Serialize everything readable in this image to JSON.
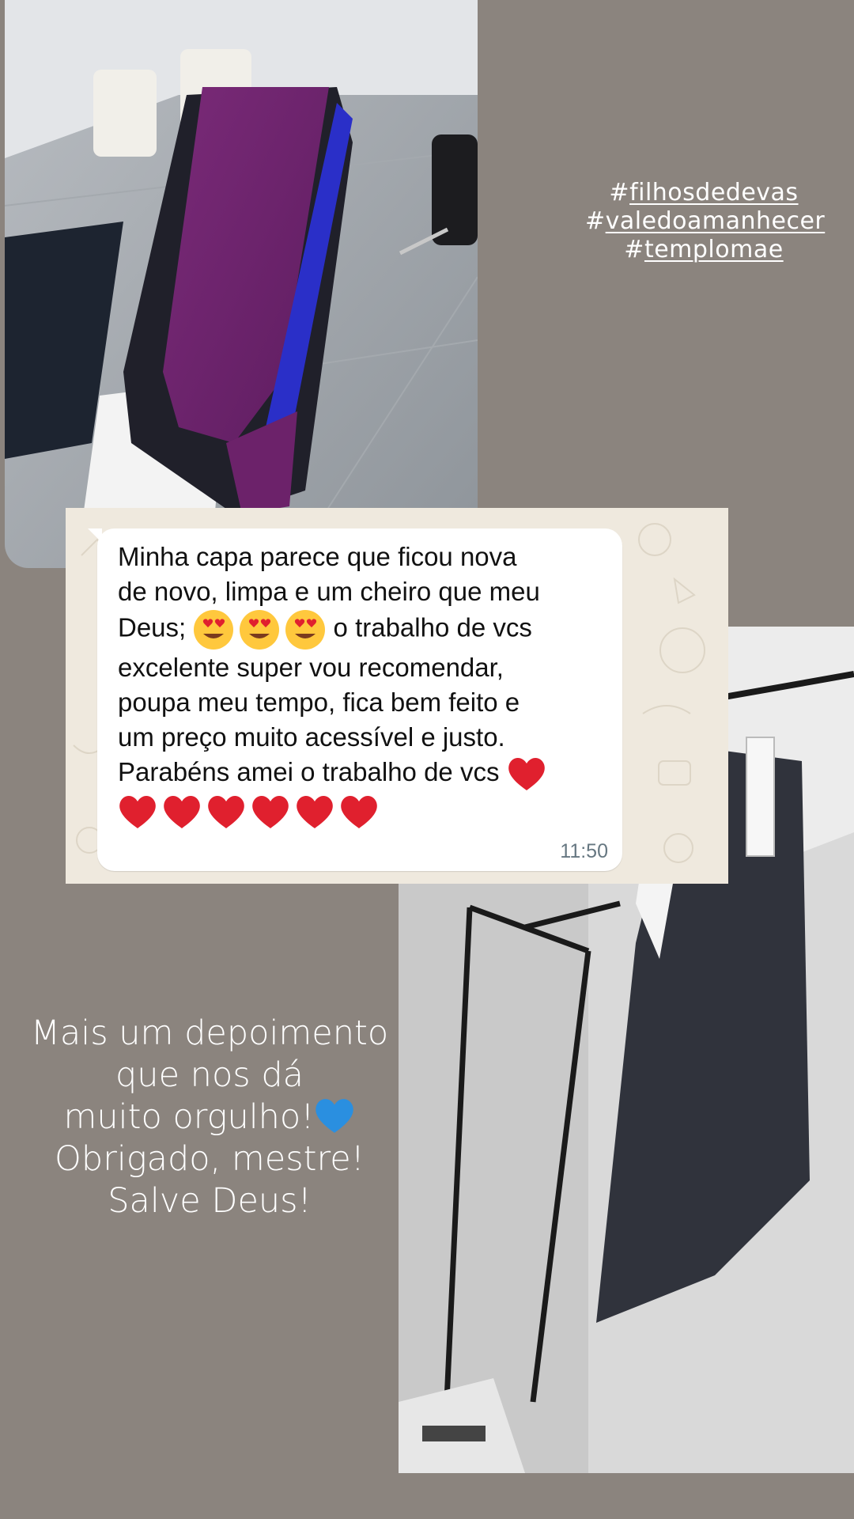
{
  "hashtags": [
    {
      "symbol": "#",
      "text": "filhosdedevas"
    },
    {
      "symbol": "#",
      "text": "valedoamanhecer"
    },
    {
      "symbol": "#",
      "text": "templomae"
    }
  ],
  "message": {
    "line1": "Minha capa parece que ficou nova",
    "line2": "de novo, limpa e um cheiro que meu",
    "line3_start": "Deus; ",
    "line3_end": " o trabalho de vcs",
    "line4": "excelente super vou recomendar,",
    "line5": "poupa meu tempo, fica bem feito e",
    "line6": "um preço muito acessível e justo.",
    "line7": "Parabéns amei o trabalho de vcs ",
    "time": "11:50",
    "emoji_love_count": 3,
    "emoji_heart_count": 7,
    "emoji_names": [
      "heart-eyes-emoji",
      "red-heart-emoji"
    ]
  },
  "caption": {
    "line1": "Mais um depoimento",
    "line2": "que nos dá",
    "line3": "muito orgulho!",
    "line4": "Obrigado, mestre!",
    "line5": "Salve Deus!",
    "emoji": "blue-heart-emoji"
  },
  "colors": {
    "background": "#8b847e",
    "chat_wallpaper": "#efe9de",
    "bubble": "#ffffff",
    "heart_red": "#e0202e",
    "heart_blue": "#2a8fe0"
  }
}
